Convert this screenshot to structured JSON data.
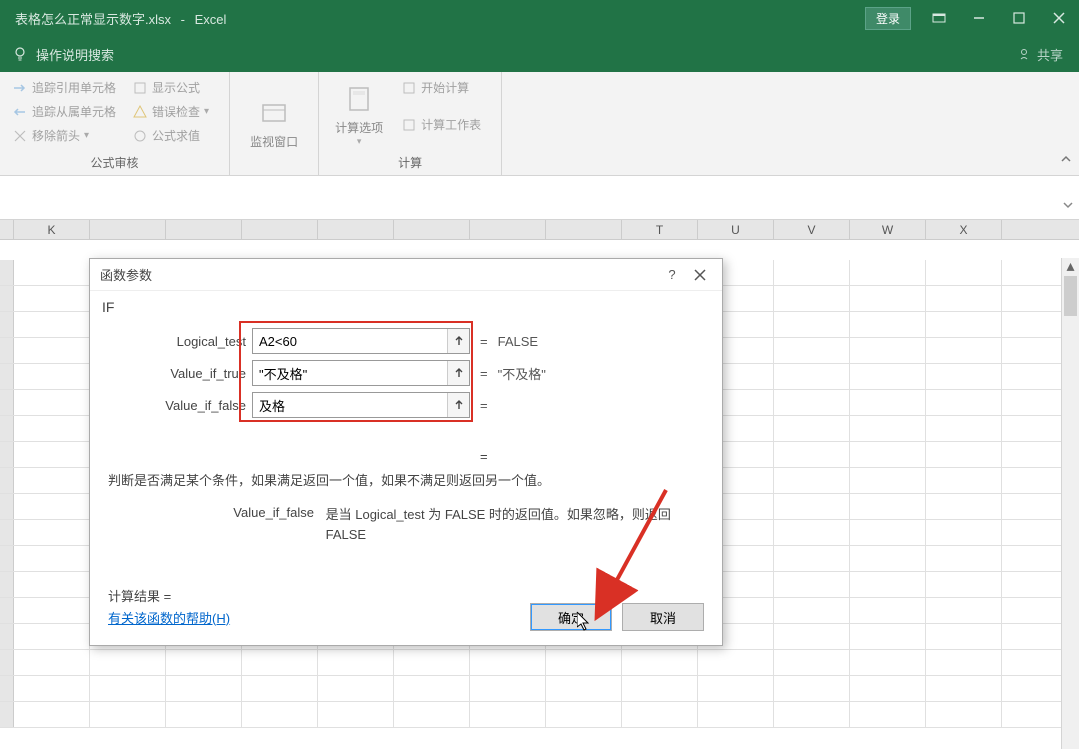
{
  "titlebar": {
    "filename": "表格怎么正常显示数字.xlsx",
    "appname": "Excel",
    "login": "登录"
  },
  "tellme": {
    "placeholder": "操作说明搜索",
    "share": "共享"
  },
  "ribbon": {
    "group1_label": "公式审核",
    "group2_label": "计算",
    "trace_precedents": "追踪引用单元格",
    "trace_dependents": "追踪从属单元格",
    "remove_arrows": "移除箭头",
    "show_formulas": "显示公式",
    "error_check": "错误检查",
    "evaluate_formula": "公式求值",
    "watch_window": "监视窗口",
    "calc_options": "计算选项",
    "calc_now": "开始计算",
    "calc_sheet": "计算工作表"
  },
  "columns": [
    "K",
    "",
    "",
    "",
    "",
    "",
    "",
    "",
    "T",
    "U",
    "V",
    "W",
    "X"
  ],
  "dialog": {
    "title": "函数参数",
    "fn": "IF",
    "arg1_label": "Logical_test",
    "arg1_value": "A2<60",
    "arg1_result": "FALSE",
    "arg2_label": "Value_if_true",
    "arg2_value": "\"不及格\"",
    "arg2_result": "\"不及格\"",
    "arg3_label": "Value_if_false",
    "arg3_value": "及格",
    "arg3_result": "",
    "description": "判断是否满足某个条件，如果满足返回一个值，如果不满足则返回另一个值。",
    "param_name": "Value_if_false",
    "param_desc": "是当 Logical_test 为 FALSE 时的返回值。如果忽略，则返回 FALSE",
    "result_label": "计算结果 =",
    "help": "有关该函数的帮助(H)",
    "ok": "确定",
    "cancel": "取消"
  }
}
